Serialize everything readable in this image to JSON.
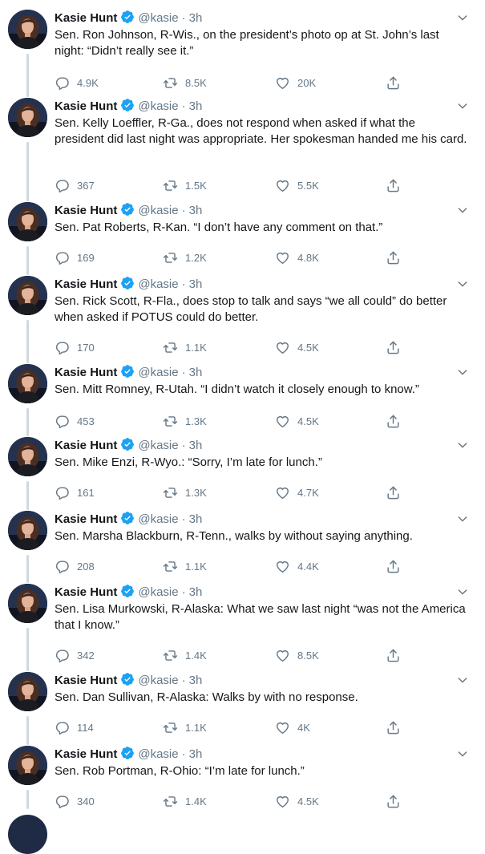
{
  "thread": {
    "tweets": [
      {
        "name": "Kasie Hunt",
        "handle": "@kasie",
        "time": "3h",
        "text": "Sen. Ron Johnson, R-Wis., on the president’s photo op at St. John’s last night: “Didn’t really see it.”",
        "replies": "4.9K",
        "retweets": "8.5K",
        "likes": "20K"
      },
      {
        "name": "Kasie Hunt",
        "handle": "@kasie",
        "time": "3h",
        "text": "Sen. Kelly Loeffler, R-Ga., does not respond when asked if what the president did last night was appropriate. Her spokesman handed me his card.",
        "replies": "367",
        "retweets": "1.5K",
        "likes": "5.5K"
      },
      {
        "name": "Kasie Hunt",
        "handle": "@kasie",
        "time": "3h",
        "text": "Sen. Pat Roberts, R-Kan. “I don’t have any comment on that.”",
        "replies": "169",
        "retweets": "1.2K",
        "likes": "4.8K"
      },
      {
        "name": "Kasie Hunt",
        "handle": "@kasie",
        "time": "3h",
        "text": "Sen. Rick Scott, R-Fla., does stop to talk and says “we all could” do better when asked if POTUS could do better.",
        "replies": "170",
        "retweets": "1.1K",
        "likes": "4.5K"
      },
      {
        "name": "Kasie Hunt",
        "handle": "@kasie",
        "time": "3h",
        "text": "Sen. Mitt Romney, R-Utah. “I didn’t watch it closely enough to know.”",
        "replies": "453",
        "retweets": "1.3K",
        "likes": "4.5K"
      },
      {
        "name": "Kasie Hunt",
        "handle": "@kasie",
        "time": "3h",
        "text": "Sen. Mike Enzi, R-Wyo.: “Sorry, I’m late for lunch.”",
        "replies": "161",
        "retweets": "1.3K",
        "likes": "4.7K"
      },
      {
        "name": "Kasie Hunt",
        "handle": "@kasie",
        "time": "3h",
        "text": "Sen. Marsha Blackburn, R-Tenn., walks by without saying anything.",
        "replies": "208",
        "retweets": "1.1K",
        "likes": "4.4K"
      },
      {
        "name": "Kasie Hunt",
        "handle": "@kasie",
        "time": "3h",
        "text": "Sen. Lisa Murkowski, R-Alaska: What we saw last night “was not the America that I know.”",
        "replies": "342",
        "retweets": "1.4K",
        "likes": "8.5K"
      },
      {
        "name": "Kasie Hunt",
        "handle": "@kasie",
        "time": "3h",
        "text": "Sen. Dan Sullivan, R-Alaska: Walks by with no response.",
        "replies": "114",
        "retweets": "1.1K",
        "likes": "4K"
      },
      {
        "name": "Kasie Hunt",
        "handle": "@kasie",
        "time": "3h",
        "text": "Sen. Rob Portman, R-Ohio: “I’m late for lunch.”",
        "replies": "340",
        "retweets": "1.4K",
        "likes": "4.5K"
      }
    ]
  },
  "colors": {
    "verified": "#1da1f2",
    "secondary_text": "#657786",
    "thread_line": "#cfd9de"
  },
  "icons": {
    "reply": "reply-icon",
    "retweet": "retweet-icon",
    "like": "like-icon",
    "share": "share-icon",
    "verified": "verified-badge-icon",
    "caret": "chevron-down-icon"
  }
}
